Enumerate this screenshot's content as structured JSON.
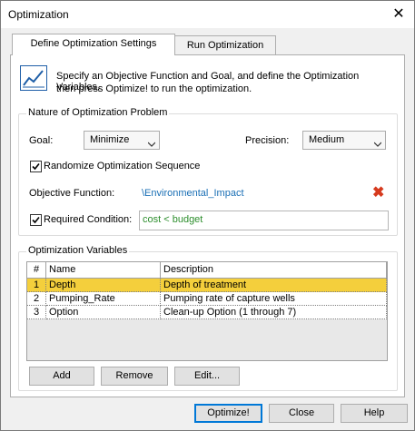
{
  "window": {
    "title": "Optimization",
    "close_glyph": "✕"
  },
  "tabs": [
    {
      "label": "Define Optimization Settings",
      "active": true
    },
    {
      "label": "Run Optimization",
      "active": false
    }
  ],
  "intro": {
    "icon": "chart-icon",
    "text_line1": "Specify an Objective Function and Goal, and define the Optimization Variables,",
    "text_line2": "then press Optimize! to run the optimization."
  },
  "nature": {
    "group_label": "Nature of Optimization Problem",
    "goal_label": "Goal:",
    "goal_value": "Minimize",
    "precision_label": "Precision:",
    "precision_value": "Medium",
    "randomize_label": "Randomize Optimization Sequence",
    "randomize_checked": true,
    "objective_label": "Objective Function:",
    "objective_value": "\\Environmental_Impact",
    "required_label": "Required Condition:",
    "required_checked": true,
    "required_value": "cost < budget",
    "delete_glyph": "✖"
  },
  "variables": {
    "group_label": "Optimization Variables",
    "columns": {
      "num": "#",
      "name": "Name",
      "description": "Description"
    },
    "rows": [
      {
        "num": "1",
        "name": "Depth",
        "description": "Depth of treatment"
      },
      {
        "num": "2",
        "name": "Pumping_Rate",
        "description": "Pumping rate of capture wells"
      },
      {
        "num": "3",
        "name": "Option",
        "description": "Clean-up Option (1 through 7)"
      }
    ],
    "add_label": "Add",
    "remove_label": "Remove",
    "edit_label": "Edit..."
  },
  "footer": {
    "optimize_label": "Optimize!",
    "close_label": "Close",
    "help_label": "Help"
  },
  "colors": {
    "selected_row": "#f4cf3c",
    "link": "#1a6fb5",
    "condition_text": "#2d8e2d",
    "delete_icon": "#d63a1e"
  }
}
